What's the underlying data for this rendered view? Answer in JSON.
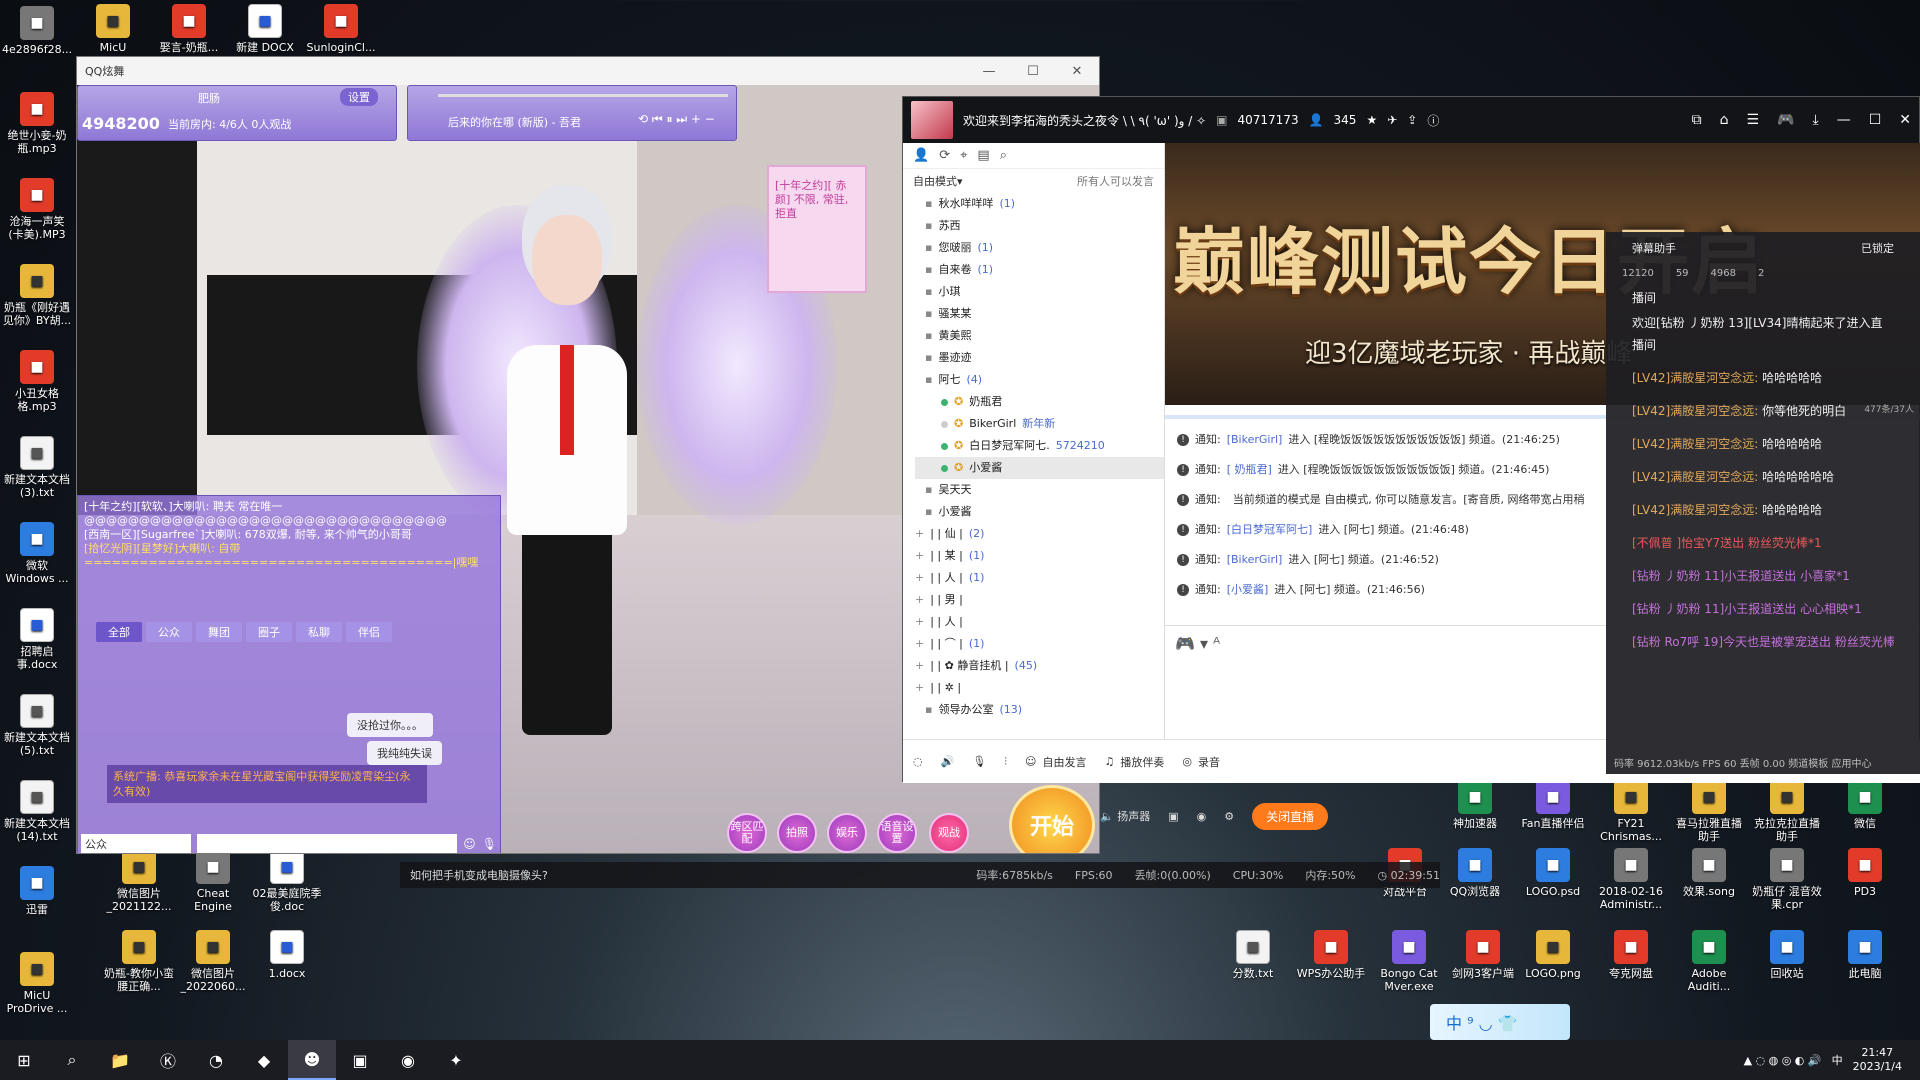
{
  "desktop_left": [
    {
      "label": "4e2896f28...",
      "icon": "qr-icon"
    },
    {
      "label": "绝世小妾-奶瓶.mp3",
      "icon": "audio-icon"
    },
    {
      "label": "沧海一声笑(卡美).MP3",
      "icon": "audio-icon"
    },
    {
      "label": "奶瓶《刚好遇见你》BY胡...",
      "icon": "image-icon"
    },
    {
      "label": "小丑女格格.mp3",
      "icon": "audio-icon"
    },
    {
      "label": "新建文本文档(3).txt",
      "icon": "text-icon"
    },
    {
      "label": "微软 Windows ...",
      "icon": "windows-icon"
    },
    {
      "label": "招聘启事.docx",
      "icon": "word-icon"
    },
    {
      "label": "新建文本文档(5).txt",
      "icon": "text-icon"
    },
    {
      "label": "新建文本文档(14).txt",
      "icon": "text-icon"
    },
    {
      "label": "迅雷",
      "icon": "thunder-icon"
    },
    {
      "label": "MicU ProDrive ...",
      "icon": "folder-icon"
    }
  ],
  "desktop_top": [
    {
      "label": "MicU",
      "icon": "folder-icon"
    },
    {
      "label": "娶言-奶瓶...",
      "icon": "audio-icon"
    },
    {
      "label": "新建 DOCX",
      "icon": "word-icon"
    },
    {
      "label": "SunloginCl...",
      "icon": "sunlogin-icon"
    }
  ],
  "desktop_bottom": [
    {
      "label": "微信图片_2021122...",
      "icon": "image-icon"
    },
    {
      "label": "Cheat Engine",
      "icon": "cheat-engine-icon"
    },
    {
      "label": "02最美庭院季俊.doc",
      "icon": "word-icon"
    },
    {
      "label": "奶瓶-教你小蛮腰正确...",
      "icon": "image-icon"
    },
    {
      "label": "微信图片_2022060...",
      "icon": "image-icon"
    },
    {
      "label": "1.docx",
      "icon": "word-icon"
    }
  ],
  "desktop_right": [
    {
      "label": "神加速器",
      "icon": "accelerator-icon"
    },
    {
      "label": "Fan直播伴侣",
      "icon": "stream-icon"
    },
    {
      "label": "FY21 Chrismas...",
      "icon": "image-icon"
    },
    {
      "label": "喜马拉雅直播助手",
      "icon": "ximalaya-icon"
    },
    {
      "label": "克拉克拉直播助手",
      "icon": "kela-icon"
    },
    {
      "label": "微信",
      "icon": "wechat-icon"
    },
    {
      "label": "QQ浏览器",
      "icon": "browser-icon"
    },
    {
      "label": "LOGO.psd",
      "icon": "photoshop-icon"
    },
    {
      "label": "2018-02-16 Administr...",
      "icon": "file-icon"
    },
    {
      "label": "效果.song",
      "icon": "file-icon"
    },
    {
      "label": "奶瓶仔 混音效果.cpr",
      "icon": "file-icon"
    },
    {
      "label": "PD3",
      "icon": "pd-icon"
    },
    {
      "label": "分数.txt",
      "icon": "text-icon"
    },
    {
      "label": "WPS办公助手",
      "icon": "wps-icon"
    },
    {
      "label": "Bongo Cat Mver.exe",
      "icon": "cat-icon"
    },
    {
      "label": "剑网3客户端",
      "icon": "game-icon"
    },
    {
      "label": "LOGO.png",
      "icon": "image-icon"
    },
    {
      "label": "夸克网盘",
      "icon": "quark-icon"
    },
    {
      "label": "Adobe Auditi...",
      "icon": "audition-icon"
    },
    {
      "label": "回收站",
      "icon": "recycle-icon"
    },
    {
      "label": "此电脑",
      "icon": "computer-icon"
    },
    {
      "label": "对战平台",
      "icon": "game-icon"
    }
  ],
  "game": {
    "title": "QQ炫舞",
    "room_name": "肥肠",
    "settings_label": "设置",
    "room_info": "当前房内: 4/6人   0人观战",
    "room_id": "4948200",
    "song": "后来的你在哪 (新版) - 吾君",
    "chat_lines": [
      {
        "text": "[十年之约][软软、]大喇叭: 聘夫 常在唯一",
        "color": "#ffffff"
      },
      {
        "text": "@@@@@@@@@@@@@@@@@@@@@@@@@@@@@@@@@",
        "color": "#ffffff"
      },
      {
        "text": "[西南一区][Sugarfree`]大喇叭: 678双爆, 耐等, 来个帅气的小哥哥",
        "color": "#ffffff"
      },
      {
        "text": "[拾忆光阴][星梦好]大喇叭: 自带",
        "color": "#ffe066"
      },
      {
        "text": "========================================|嘿嘿",
        "color": "#ffe066"
      }
    ],
    "chat_tabs": [
      "全部",
      "公众",
      "舞团",
      "圈子",
      "私聊",
      "伴侣"
    ],
    "bubble1": "没抢过你。。。",
    "bubble2": "我纯纯失误",
    "broadcast": "系统广播: 恭喜玩家余未在星光藏宝阁中获得奖励凌霄染尘(永久有效)",
    "channel": "公众",
    "notice_card": "[十年之约][ 赤颜] 不限, 常驻, 拒直",
    "btn_cross": "跨区匹配",
    "btn_photo": "拍照",
    "btn_fun": "娱乐",
    "btn_voice": "语音设置",
    "btn_watch": "观战",
    "btn_start": "开始"
  },
  "live": {
    "channel_title": "欢迎来到李拓海的秃头之夜令 \\ \\ ٩( 'ω' )و / ✧",
    "channel_id": "40717173",
    "online": "345",
    "mode": "自由模式",
    "perm": "所有人可以发言",
    "members": [
      {
        "name": "秋水咩咩咩",
        "count": "(1)",
        "kind": "room"
      },
      {
        "name": "苏西",
        "count": "",
        "kind": "room"
      },
      {
        "name": "您啵丽",
        "count": "(1)",
        "kind": "room"
      },
      {
        "name": "自来卷",
        "count": "(1)",
        "kind": "room"
      },
      {
        "name": "小琪",
        "count": "",
        "kind": "room"
      },
      {
        "name": "骚某某",
        "count": "",
        "kind": "room"
      },
      {
        "name": "黄美熙",
        "count": "",
        "kind": "room"
      },
      {
        "name": "墨迹迹",
        "count": "",
        "kind": "room"
      },
      {
        "name": "阿七",
        "count": "(4)",
        "kind": "room"
      },
      {
        "name": "奶瓶君",
        "count": "",
        "kind": "user"
      },
      {
        "name": "BikerGirl",
        "count": "新年新",
        "kind": "user-off"
      },
      {
        "name": "白日梦冠军阿七.",
        "count": "5724210",
        "kind": "user"
      },
      {
        "name": "小爱酱",
        "count": "",
        "kind": "user-hl"
      },
      {
        "name": "吴天天",
        "count": "",
        "kind": "room"
      },
      {
        "name": "小爱酱",
        "count": "",
        "kind": "room"
      },
      {
        "name": "| |  仙  |",
        "count": "(2)",
        "kind": "group"
      },
      {
        "name": "| |  某  |",
        "count": "(1)",
        "kind": "group"
      },
      {
        "name": "| |  人  |",
        "count": "(1)",
        "kind": "group"
      },
      {
        "name": "| |  男  |",
        "count": "",
        "kind": "group"
      },
      {
        "name": "| |  人  |",
        "count": "",
        "kind": "group"
      },
      {
        "name": "| |  ⌒  |",
        "count": "(1)",
        "kind": "group"
      },
      {
        "name": "| |  ✿ 静音挂机  |",
        "count": "(45)",
        "kind": "group"
      },
      {
        "name": "| |  ✲  |",
        "count": "",
        "kind": "group"
      },
      {
        "name": "领导办公室",
        "count": "(13)",
        "kind": "room"
      }
    ],
    "banner_big": "巅峰测试今日开启",
    "banner_small": "迎3亿魔域老玩家 · 再战巅峰",
    "notices": [
      {
        "a": "通知:",
        "b": "[BikerGirl]",
        "c": "进入 [程晚饭饭饭饭饭饭饭饭饭饭饭] 频道。(21:46:25)"
      },
      {
        "a": "通知:",
        "b": "[  奶瓶君]",
        "c": "进入 [程晚饭饭饭饭饭饭饭饭饭饭饭] 频道。(21:46:45)"
      },
      {
        "a": "通知:",
        "b": "",
        "c": "当前频道的模式是 自由模式, 你可以随意发言。[寄音质, 网络带宽占用稍"
      },
      {
        "a": "通知:",
        "b": "[白日梦冠军阿七]",
        "c": "进入 [阿七] 频道。(21:46:48)"
      },
      {
        "a": "通知:",
        "b": "[BikerGirl]",
        "c": "进入 [阿七] 频道。(21:46:52)"
      },
      {
        "a": "通知:",
        "b": "[小爱酱]",
        "c": "进入 [阿七] 频道。(21:46:56)"
      }
    ],
    "bottom": {
      "free_speak": "自由发言",
      "accompany": "播放伴奏",
      "record": "录音"
    },
    "danmu": {
      "title": "弹幕助手",
      "status": "已锁定",
      "stats": [
        "12120",
        "59",
        "4968",
        "2"
      ],
      "header": "播间",
      "welcome": "欢迎[钻粉 丿奶粉 13][LV34]晴楠起来了进入直播间",
      "counter": "477条/37人",
      "msgs": [
        {
          "lv": "[LV42]满胺星河空念远:",
          "t": "哈哈哈哈哈",
          "cls": "lv"
        },
        {
          "lv": "[LV42]满胺星河空念远:",
          "t": "你等他死的明白",
          "cls": "lv"
        },
        {
          "lv": "[LV42]满胺星河空念远:",
          "t": "哈哈哈哈哈",
          "cls": "lv"
        },
        {
          "lv": "[LV42]满胺星河空念远:",
          "t": "哈哈哈哈哈哈",
          "cls": "lv"
        },
        {
          "lv": "[LV42]满胺星河空念远:",
          "t": "哈哈哈哈哈",
          "cls": "lv"
        },
        {
          "lv": "[不佩普 ]怡宝Y7送出",
          "t": "粉丝荧光棒*1",
          "cls": "red"
        },
        {
          "lv": "[钻粉 丿奶粉 11]小王报道送出",
          "t": "小喜家*1",
          "cls": "pk"
        },
        {
          "lv": "[钻粉 丿奶粉 11]小王报道送出",
          "t": "心心相映*1",
          "cls": "pk"
        },
        {
          "lv": "[钻粉 Ro7呼 19]今天也是被掌宠送出",
          "t": "粉丝荧光棒*10",
          "cls": "pk"
        }
      ],
      "foot": "码率 9612.03kb/s  FPS 60  丢帧 0.00",
      "foot2": "频道模板",
      "foot3": "应用中心"
    },
    "stream_bar": {
      "speaker": "扬声器",
      "close_live": "关闭直播"
    }
  },
  "status_bar": {
    "question": "如何把手机变成电脑摄像头?",
    "bitrate": "码率:6785kb/s",
    "fps": "FPS:60",
    "drop": "丢帧:0(0.00%)",
    "cpu": "CPU:30%",
    "mem": "内存:50%",
    "time": "02:39:51"
  },
  "ime": "中 ⁹ ◡ 👕",
  "taskbar": {
    "time": "21:47",
    "date": "2023/1/4",
    "lang": "中"
  }
}
